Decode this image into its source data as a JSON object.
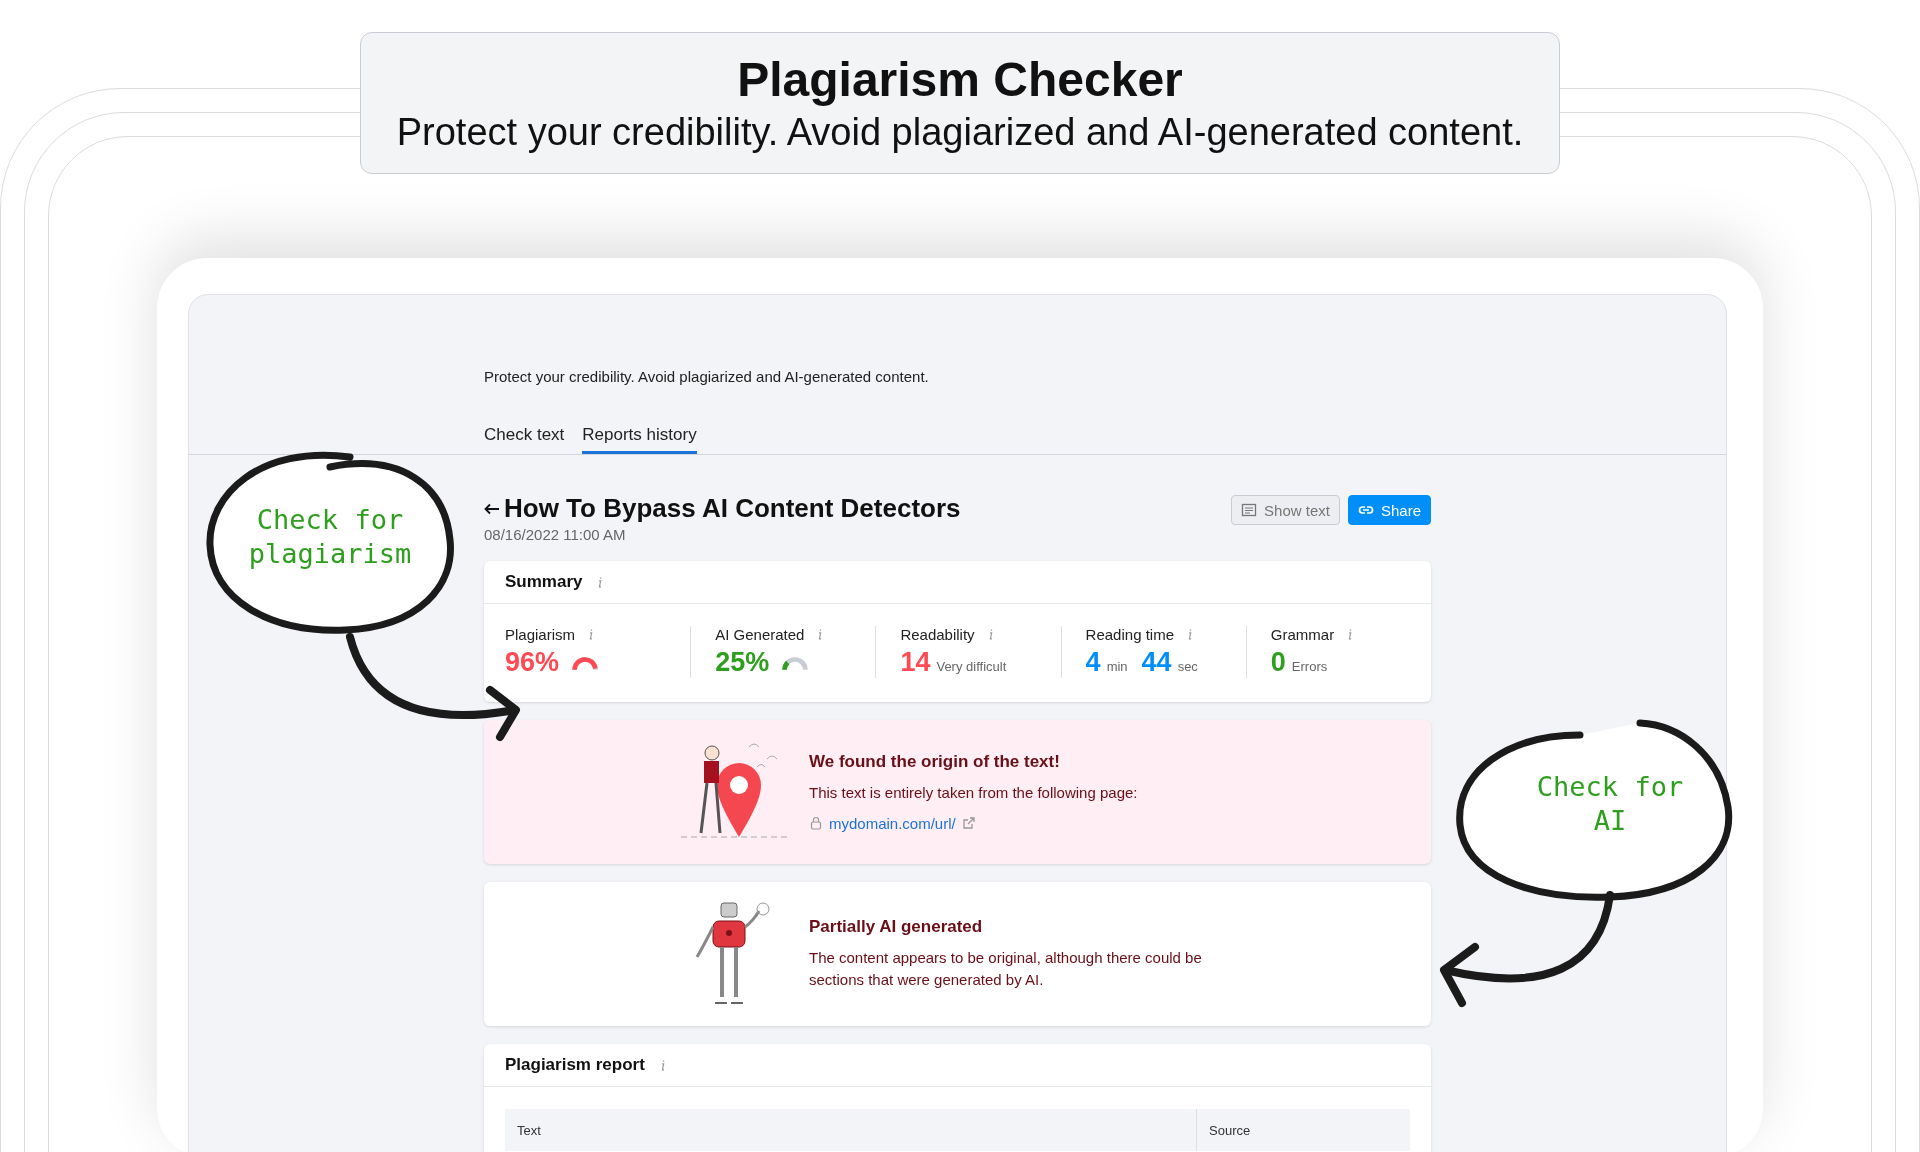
{
  "banner": {
    "title": "Plagiarism Checker",
    "subtitle": "Protect your credibility. Avoid plagiarized and AI-generated content."
  },
  "page": {
    "description": "Protect your credibility. Avoid plagiarized and AI-generated content.",
    "tabs": [
      {
        "label": "Check text",
        "selected": false
      },
      {
        "label": "Reports history",
        "selected": true
      }
    ],
    "report": {
      "title": "How To Bypass AI Content Detectors",
      "date": "08/16/2022 11:00 AM",
      "buttons": [
        {
          "label": "Show text",
          "kind": "secondary"
        },
        {
          "label": "Share",
          "kind": "primary"
        }
      ]
    },
    "summary": {
      "title": "Summary",
      "metrics": [
        {
          "label": "Plagiarism",
          "color": "#ff4953",
          "level": 0.96,
          "parts": [
            {
              "text": "96%",
              "kind": "number"
            }
          ]
        },
        {
          "label": "AI Generated",
          "color": "#2e9e1e",
          "level": 0.25,
          "parts": [
            {
              "text": "25%",
              "kind": "number"
            }
          ]
        },
        {
          "label": "Readability",
          "color": "#ff4953",
          "parts": [
            {
              "text": "14",
              "kind": "number"
            },
            {
              "text": "Very difficult",
              "kind": "unit"
            }
          ]
        },
        {
          "label": "Reading time",
          "color": "#008ff8",
          "parts": [
            {
              "text": "4",
              "kind": "number"
            },
            {
              "text": "min",
              "kind": "unit"
            },
            {
              "text": "44",
              "kind": "number"
            },
            {
              "text": "sec",
              "kind": "unit"
            }
          ]
        },
        {
          "label": "Grammar",
          "color": "#2e9e1e",
          "parts": [
            {
              "text": "0",
              "kind": "number"
            },
            {
              "text": "Errors",
              "kind": "unit"
            }
          ]
        }
      ]
    },
    "origin": {
      "title": "We found the origin of the text!",
      "text": "This text is entirely taken from the following page:",
      "link": "mydomain.com/url/"
    },
    "ai": {
      "title": "Partially AI generated",
      "text": "The content appears to be original, although there could be sections that were generated by AI."
    },
    "plagiarism_report": {
      "title": "Plagiarism report",
      "columns": [
        "Text",
        "Source"
      ]
    }
  },
  "annotations": [
    {
      "text": "Check for plagiarism"
    },
    {
      "text": "Check for AI"
    }
  ]
}
